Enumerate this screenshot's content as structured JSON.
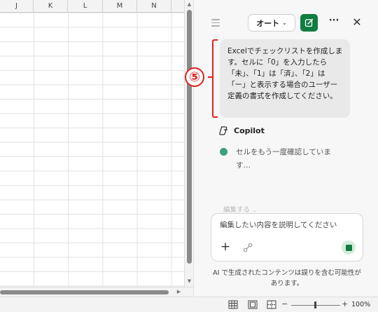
{
  "sheet": {
    "columns": [
      "J",
      "K",
      "L",
      "M",
      "N"
    ]
  },
  "copilot": {
    "mode_label": "オート",
    "user_message": "Excelでチェックリストを作成します。セルに「0」を入力したら「未」、「1」は「済」、「2」は「ー」と表示する場合のユーザー定義の書式を作成してください。",
    "assistant_name": "Copilot",
    "status_text": "セルをもう一度確認していま\nす…",
    "edit_hint": "編集する",
    "compose_placeholder": "編集したい内容を説明してください",
    "disclaimer": "AI で生成されたコンテンツは誤りを含む可能性があります。"
  },
  "annotation": {
    "step_label": "⑤",
    "color": "#dd2222"
  },
  "statusbar": {
    "zoom_minus": "−",
    "zoom_plus": "+",
    "zoom_level": "100%",
    "zoom_fraction": 0.5
  },
  "colors": {
    "accent_green": "#107c41",
    "status_dot": "#3aa07a"
  }
}
